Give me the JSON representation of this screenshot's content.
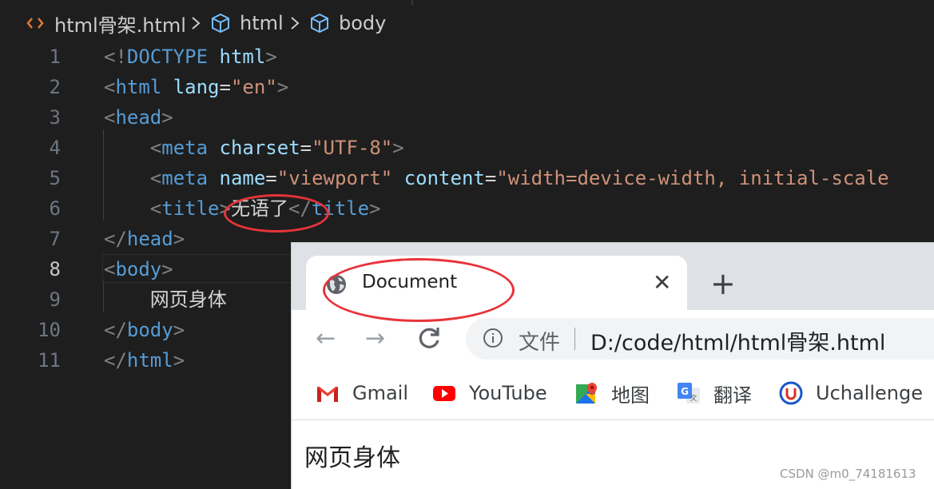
{
  "editor": {
    "breadcrumb": [
      "html骨架.html",
      "html",
      "body"
    ],
    "lines": [
      {
        "n": "1",
        "parts": [
          [
            "punc",
            "<!"
          ],
          [
            "tag",
            "DOCTYPE"
          ],
          [
            "txt",
            " "
          ],
          [
            "attr",
            "html"
          ],
          [
            "punc",
            ">"
          ]
        ]
      },
      {
        "n": "2",
        "parts": [
          [
            "punc",
            "<"
          ],
          [
            "tag",
            "html"
          ],
          [
            "txt",
            " "
          ],
          [
            "attr",
            "lang"
          ],
          [
            "txt",
            "="
          ],
          [
            "str",
            "\"en\""
          ],
          [
            "punc",
            ">"
          ]
        ]
      },
      {
        "n": "3",
        "parts": [
          [
            "punc",
            "<"
          ],
          [
            "tag",
            "head"
          ],
          [
            "punc",
            ">"
          ]
        ]
      },
      {
        "n": "4",
        "parts": [
          [
            "txt",
            "    "
          ],
          [
            "punc",
            "<"
          ],
          [
            "tag",
            "meta"
          ],
          [
            "txt",
            " "
          ],
          [
            "attr",
            "charset"
          ],
          [
            "txt",
            "="
          ],
          [
            "str",
            "\"UTF-8\""
          ],
          [
            "punc",
            ">"
          ]
        ]
      },
      {
        "n": "5",
        "parts": [
          [
            "txt",
            "    "
          ],
          [
            "punc",
            "<"
          ],
          [
            "tag",
            "meta"
          ],
          [
            "txt",
            " "
          ],
          [
            "attr",
            "name"
          ],
          [
            "txt",
            "="
          ],
          [
            "str",
            "\"viewport\""
          ],
          [
            "txt",
            " "
          ],
          [
            "attr",
            "content"
          ],
          [
            "txt",
            "="
          ],
          [
            "str",
            "\"width=device-width, initial-scale"
          ]
        ]
      },
      {
        "n": "6",
        "parts": [
          [
            "txt",
            "    "
          ],
          [
            "punc",
            "<"
          ],
          [
            "tag",
            "title"
          ],
          [
            "punc",
            ">"
          ],
          [
            "txt",
            "无语了"
          ],
          [
            "punc",
            "</"
          ],
          [
            "tag",
            "title"
          ],
          [
            "punc",
            ">"
          ]
        ]
      },
      {
        "n": "7",
        "parts": [
          [
            "punc",
            "</"
          ],
          [
            "tag",
            "head"
          ],
          [
            "punc",
            ">"
          ]
        ]
      },
      {
        "n": "8",
        "parts": [
          [
            "punc",
            "<"
          ],
          [
            "tag",
            "body"
          ],
          [
            "punc",
            ">"
          ]
        ]
      },
      {
        "n": "9",
        "parts": [
          [
            "txt",
            "    网页身体"
          ]
        ]
      },
      {
        "n": "10",
        "parts": [
          [
            "punc",
            "</"
          ],
          [
            "tag",
            "body"
          ],
          [
            "punc",
            ">"
          ]
        ]
      },
      {
        "n": "11",
        "parts": [
          [
            "punc",
            "</"
          ],
          [
            "tag",
            "html"
          ],
          [
            "punc",
            ">"
          ]
        ]
      }
    ],
    "active_line": "8"
  },
  "browser": {
    "tab_title": "Document",
    "close_glyph": "✕",
    "new_tab_glyph": "+",
    "back_glyph": "←",
    "forward_glyph": "→",
    "omnibox_label": "文件",
    "url": "D:/code/html/html骨架.html",
    "bookmarks": [
      "Gmail",
      "YouTube",
      "地图",
      "翻译",
      "Uchallenge"
    ],
    "page_text": "网页身体"
  },
  "watermark": "CSDN @m0_74181613",
  "colors": {
    "tag": "#569cd6",
    "attribute": "#9cdcfe",
    "string": "#ce9178",
    "annotation": "#e8333a"
  }
}
